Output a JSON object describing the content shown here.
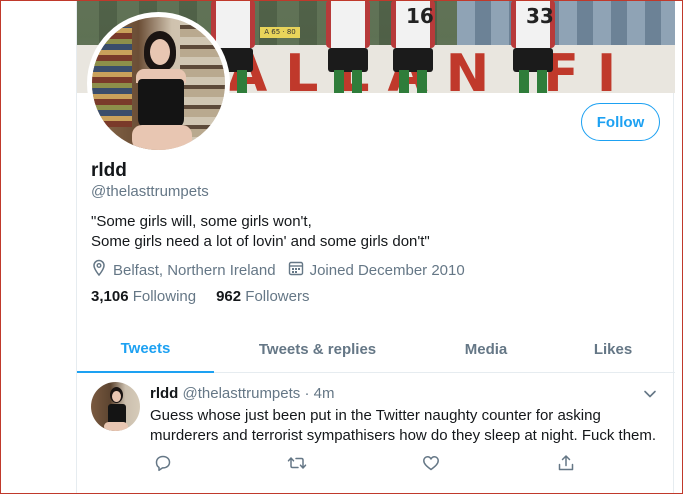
{
  "banner": {
    "wall_text": "ALLAN   FI",
    "sign_text": "A 65 · 80",
    "player_numbers": [
      "",
      "",
      "16",
      "33"
    ]
  },
  "profile": {
    "display_name": "rldd",
    "handle": "@thelasttrumpets",
    "bio_lines": [
      "\"Some girls will, some girls won't,",
      "Some girls need a lot of lovin' and some girls don't\""
    ],
    "location": "Belfast, Northern Ireland",
    "joined": "Joined December 2010",
    "following_count": "3,106",
    "following_label": "Following",
    "followers_count": "962",
    "followers_label": "Followers",
    "follow_button": "Follow"
  },
  "tabs": [
    {
      "label": "Tweets",
      "active": true
    },
    {
      "label": "Tweets & replies",
      "active": false
    },
    {
      "label": "Media",
      "active": false
    },
    {
      "label": "Likes",
      "active": false
    }
  ],
  "tweet": {
    "name": "rldd",
    "handle": "@thelasttrumpets",
    "separator": "·",
    "time": "4m",
    "text_lines": [
      "Guess whose just been put in the Twitter naughty counter for asking",
      "murderers and terrorist sympathisers how do they sleep at night. Fuck them."
    ],
    "actions": [
      "reply-icon",
      "retweet-icon",
      "like-icon",
      "share-icon"
    ]
  },
  "colors": {
    "accent": "#1da1f2",
    "secondary_text": "#657786",
    "primary_text": "#14171a",
    "divider": "#e6ecf0",
    "frame": "#c0392b"
  }
}
